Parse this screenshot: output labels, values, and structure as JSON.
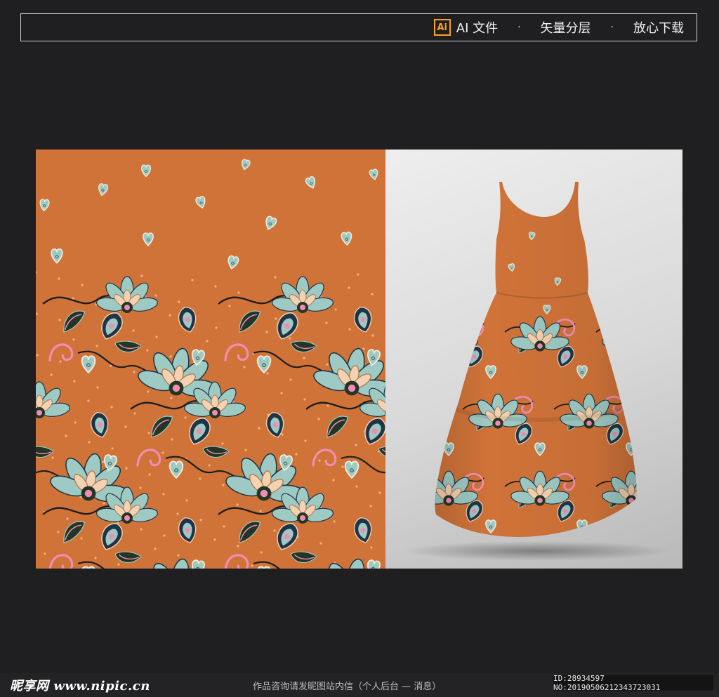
{
  "header": {
    "logo_text": "Ai",
    "file_type": "AI 文件",
    "separator": "·",
    "feature1": "矢量分层",
    "feature2": "放心下载"
  },
  "colors": {
    "background": "#1f1f21",
    "pattern_bg": "#d07339",
    "mint": "#9dcac3",
    "pink": "#ef8db4",
    "navy": "#203447",
    "cream": "#f2d2b2",
    "dark_green": "#233524"
  },
  "footer": {
    "brand": "昵享网 www.nipic.cn",
    "notice": "作品咨询请发昵图站内信（个人后台 — 消息）",
    "id_text": "ID:28934597 NO:20190506212343723031"
  }
}
